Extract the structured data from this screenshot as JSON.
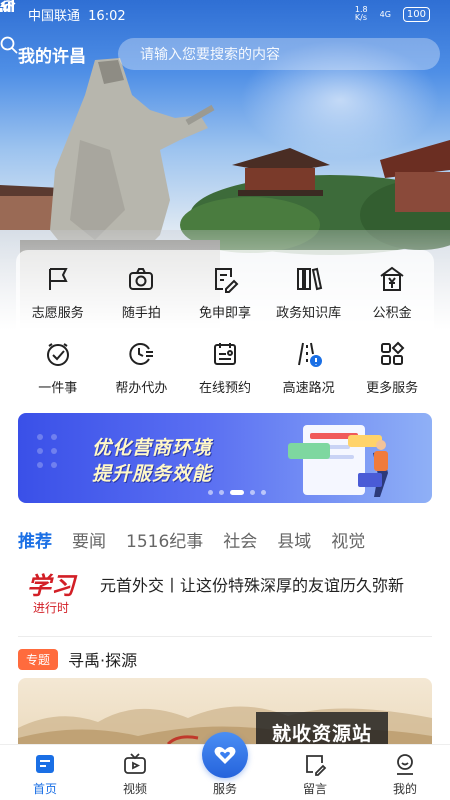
{
  "status_bar": {
    "carrier": "中国联通",
    "time": "16:02",
    "net_speed": "1.8\nK/s",
    "signal": "4G",
    "battery": "100"
  },
  "header": {
    "city_title": "我的许昌",
    "search_placeholder": "请输入您要搜索的内容"
  },
  "services": [
    {
      "label": "志愿服务",
      "icon": "flag-icon"
    },
    {
      "label": "随手拍",
      "icon": "camera-icon"
    },
    {
      "label": "免申即享",
      "icon": "document-edit-icon"
    },
    {
      "label": "政务知识库",
      "icon": "books-icon"
    },
    {
      "label": "公积金",
      "icon": "house-yen-icon"
    },
    {
      "label": "一件事",
      "icon": "check-clock-icon"
    },
    {
      "label": "帮办代办",
      "icon": "clock-list-icon"
    },
    {
      "label": "在线预约",
      "icon": "calendar-card-icon"
    },
    {
      "label": "高速路况",
      "icon": "road-alert-icon"
    },
    {
      "label": "更多服务",
      "icon": "grid-more-icon"
    }
  ],
  "banner": {
    "line1": "优化营商环境",
    "line2": "提升服务效能"
  },
  "tabs": [
    "推荐",
    "要闻",
    "1516纪事",
    "社会",
    "县域",
    "视觉"
  ],
  "news": {
    "logo_big": "学习",
    "logo_small": "进行时",
    "title": "元首外交丨让这份特殊深厚的友谊历久弥新"
  },
  "topic": {
    "badge": "专题",
    "title": "寻禹·探源"
  },
  "watermark": "就收资源站",
  "bottom_nav": [
    {
      "label": "首页",
      "icon": "home-icon",
      "active": true
    },
    {
      "label": "视频",
      "icon": "tv-icon",
      "active": false
    },
    {
      "label": "服务",
      "icon": "heart-hands-icon",
      "active": false
    },
    {
      "label": "留言",
      "icon": "message-edit-icon",
      "active": false
    },
    {
      "label": "我的",
      "icon": "user-icon",
      "active": false
    }
  ],
  "colors": {
    "primary": "#1a6fe5",
    "badge": "#ff6b3d",
    "logo_red": "#d21f26"
  }
}
